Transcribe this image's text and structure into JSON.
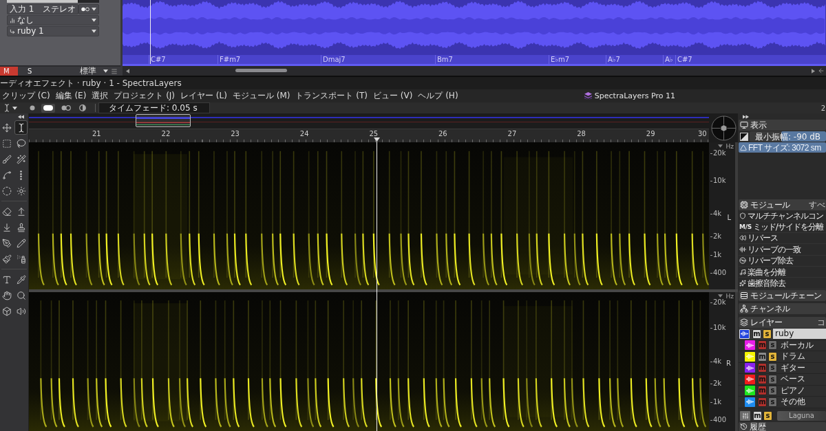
{
  "daw": {
    "fader": {
      "level": 0.77
    },
    "input_row": {
      "input": "入力 1",
      "mode": "ステレオ"
    },
    "insert_row": {
      "value": "なし"
    },
    "output_row": {
      "value": "ruby 1"
    },
    "mute": {
      "label": "M",
      "on": true
    },
    "solo": {
      "label": "S",
      "on": false
    },
    "view_mode": "標準",
    "chords": [
      "C#7",
      "F#m7",
      "Dmaj7",
      "Bm7",
      "E♭m7",
      "A♭7",
      "A♭",
      "C#7"
    ]
  },
  "window": {
    "title": "ーディオエフェクト · ruby · 1 - SpectraLayers"
  },
  "menu": [
    "クリップ (C)",
    "編集 (E)",
    "選択",
    "プロジェクト (J)",
    "レイヤー (L)",
    "モジュール (M)",
    "トランスポート (T)",
    "ビュー (V)",
    "ヘルプ (H)"
  ],
  "app_name": "SpectraLayers Pro 11",
  "toolbar": {
    "modes": [
      {
        "selected": false
      },
      {
        "selected": true
      },
      {
        "selected": false
      },
      {
        "selected": false
      }
    ],
    "time_fade": "タイムフェード: 0.05 s",
    "edge_label": "2"
  },
  "tools": [
    {
      "selected": false
    },
    {
      "selected": true
    },
    {
      "selected": false
    },
    {
      "selected": false
    },
    {
      "selected": false
    },
    {
      "selected": false
    },
    {
      "selected": false
    },
    {
      "selected": false
    },
    {
      "selected": false
    },
    {
      "selected": false
    },
    {
      "selected": false
    },
    {
      "selected": false
    },
    {
      "selected": false
    },
    {
      "selected": false
    },
    {
      "selected": false
    },
    {
      "selected": false
    },
    {
      "selected": false
    },
    {
      "selected": false
    },
    {
      "selected": false
    },
    {
      "selected": false
    },
    {
      "selected": false
    },
    {
      "selected": false
    },
    {
      "selected": false
    },
    {
      "selected": false
    }
  ],
  "ruler": [
    "21",
    "22",
    "23",
    "24",
    "25",
    "26",
    "27",
    "28",
    "29",
    "30"
  ],
  "channels": [
    {
      "name": "L",
      "unit": "Hz",
      "ticks": [
        "20k",
        "10k",
        "4k",
        "2k",
        "1k",
        "400"
      ]
    },
    {
      "name": "R",
      "unit": "Hz",
      "ticks": [
        "20k",
        "10k",
        "4k",
        "2k",
        "1k",
        "400"
      ]
    }
  ],
  "panel": {
    "display": {
      "title": "表示",
      "min_amplitude": {
        "label": "最小振幅: -90 dB",
        "level": 0.59
      },
      "fft_size": "FFT サイズ: 3072 sm"
    },
    "modules": {
      "title": "モジュール",
      "filter": "すべ",
      "items": [
        {
          "label": "マルチチャンネルコン"
        },
        {
          "badge": "M/S",
          "label": "ミッド/サイドを分離"
        },
        {
          "label": "リバース"
        },
        {
          "label": "リバーブの一致"
        },
        {
          "label": "リバーブ除去"
        },
        {
          "label": "楽曲を分離"
        },
        {
          "label": "歯擦音除去"
        }
      ]
    },
    "module_chain": {
      "title": "モジュールチェーン"
    },
    "channel": {
      "title": "チャンネル"
    },
    "layers": {
      "title": "レイヤー",
      "action": "コ",
      "root": {
        "name": "ruby",
        "selected": true,
        "mute": "m",
        "solo": "s",
        "muted": false,
        "soloed": true,
        "color": "#2244dd",
        "children": [
          {
            "name": "ボーカル",
            "selected": false,
            "mute": "m",
            "solo": "s",
            "muted": true,
            "soloed": false,
            "color": "#e81ee8"
          },
          {
            "name": "ドラム",
            "selected": false,
            "mute": "m",
            "solo": "s",
            "muted": false,
            "soloed": true,
            "color": "#f5f500"
          },
          {
            "name": "ギター",
            "selected": false,
            "mute": "m",
            "solo": "s",
            "muted": true,
            "soloed": false,
            "color": "#8a22f0"
          },
          {
            "name": "ベース",
            "selected": false,
            "mute": "m",
            "solo": "s",
            "muted": true,
            "soloed": false,
            "color": "#f01c1c"
          },
          {
            "name": "ピアノ",
            "selected": false,
            "mute": "m",
            "solo": "s",
            "muted": true,
            "soloed": false,
            "color": "#1ee61e"
          },
          {
            "name": "その他",
            "selected": false,
            "mute": "m",
            "solo": "s",
            "muted": true,
            "soloed": false,
            "color": "#1e8cf0"
          }
        ]
      }
    },
    "master_row": {
      "mute": "m",
      "solo": "s",
      "muted": false,
      "soloed": true,
      "preset": "Laguna"
    },
    "history": {
      "title": "履歴"
    }
  }
}
